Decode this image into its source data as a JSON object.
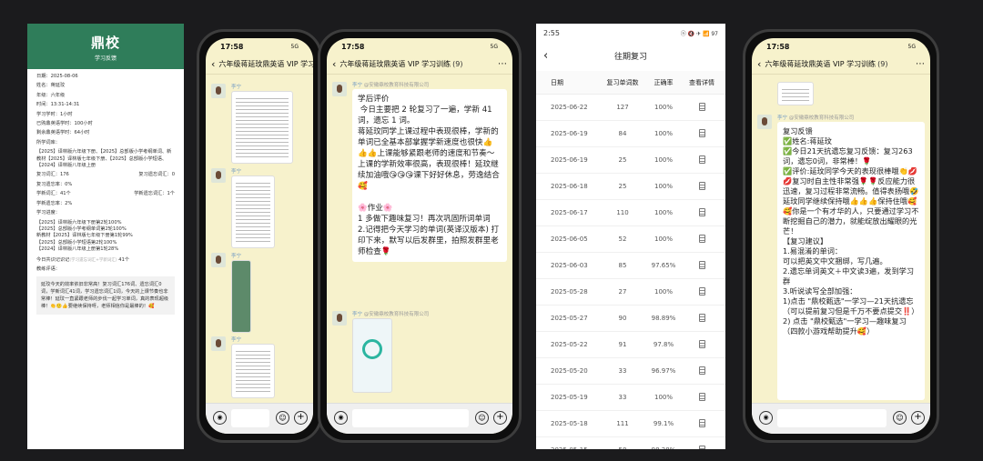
{
  "report": {
    "logo": "鼎校",
    "subtitle": "学习反馈",
    "fields": [
      "日期：2025-08-06",
      "姓名：蒋延玟",
      "年级：六年级",
      "时间：13:31-14:31",
      "学习学时：1小时",
      "已购鼎英语学时：100小时",
      "剩余鼎英语学时：64小时",
      "所学词库：",
      "【2025】译林版六年级下册、【2025】总部版小学考纲单词、新教材【2025】译林版七年级下册、【2025】总部版小学短语、【2024】译林版八年级上册"
    ],
    "stats": [
      [
        "复习词汇：176",
        "复习遗忘词汇：0"
      ],
      [
        "复习遗忘率：0%",
        ""
      ],
      [
        "学新词汇：41个",
        "学新遗忘词汇：1个"
      ],
      [
        "学新遗忘率：2%",
        ""
      ]
    ],
    "progress_label": "学习进度：",
    "progress": [
      "【2025】译林版六年级下册第2轮100%",
      "【2025】总部版小学考纲单词第2轮100%",
      "新教材【2025】译林版七年级下册第1轮99%",
      "【2025】总部版小学短语第2轮100%",
      "【2024】译林版八年级上册第1轮28%"
    ],
    "checkin": "今日共识记识记",
    "checkin_sub": "(学习遗忘词汇+学新词汇)",
    "checkin_count": "41个",
    "comment_label": "教练评语：",
    "comment": "延玟今天的效率依旧非常高！复习词汇176词、遗忘词汇0词，学新词汇41词，学习遗忘词汇1词，今天的上课节奏也非常棒！延玟一直紧跟老师的步伐一起学习单词，真的表现超级棒！👏🙂👍要继续保持呀，老师相信你是最棒的！🥰"
  },
  "chat": {
    "title": "六年级蒋延玟鼎英语 VIP 学习训练",
    "count": "(9)",
    "sender": "李宁",
    "org": "@安徽鼎校教育科技有限公司",
    "time": "17:58",
    "net": "5G"
  },
  "phone2": {
    "text1": "学后评价\n 今日主要把 2 轮复习了一遍，学新 41 词，遗忘 1 词。\n蒋延玟同学上课过程中表现很棒，学新的单词已全基本部掌握学新速度也很快👍👍👍上课能够紧跟老师的速度和节奏～上课的学新效率很高，表现很棒！延玟继续加油哦😘😘😘课下好好休息，劳逸结合🥰",
    "text2": "🌸作业🌸\n1 多做下趣味复习！再次巩固所词单词\n2.记得把今天学习的单词(英译汉版本) 打印下来，默写以后发群里，拍照发群里老师检查🌹"
  },
  "phone4": {
    "text": "复习反馈\n✅姓名:蒋延玟\n✅今日21天抗遗忘复习反馈：复习263词，遗忘0词，非常棒！🌹\n✅评价:延玟同学今天的表现很棒哦👏💋💋复习时自主性非常强🌹🌹反应能力很迅速，复习过程非常流畅。值得表扬哦🤣延玟同学继续保持哦👍👍👍保持住哦🥰🥰你是一个有才华的人，只要通过学习不断挖掘自己的潜力，就能绽放出耀眼的光芒！\n【复习建议】\n1.易混淆的单词：\n可以把英文中文捆绑，写几遍。\n2.遗忘单词英文＋中文读3遍，发到学习群\n3.听说读写全部加强：\n1)点击 \"鼎校甄选\"一学习—21天抗遗忘（可以提前复习但是千万不要点提交‼️）\n2) 点击 \"鼎校甄选\"一学习—趣味复习（四款小游戏帮助提升🥰）"
  },
  "table": {
    "time": "2:55",
    "status_right": "ⓝ 🔇 ✈ 📶 97",
    "title": "往期复习",
    "headers": [
      "日期",
      "复习单词数",
      "正确率",
      "查看详情"
    ],
    "rows": [
      [
        "2025-06-22",
        "127",
        "100%"
      ],
      [
        "2025-06-19",
        "84",
        "100%"
      ],
      [
        "2025-06-19",
        "25",
        "100%"
      ],
      [
        "2025-06-18",
        "25",
        "100%"
      ],
      [
        "2025-06-17",
        "110",
        "100%"
      ],
      [
        "2025-06-05",
        "52",
        "100%"
      ],
      [
        "2025-06-03",
        "85",
        "97.65%"
      ],
      [
        "2025-05-28",
        "27",
        "100%"
      ],
      [
        "2025-05-27",
        "90",
        "98.89%"
      ],
      [
        "2025-05-22",
        "91",
        "97.8%"
      ],
      [
        "2025-05-20",
        "33",
        "96.97%"
      ],
      [
        "2025-05-19",
        "33",
        "100%"
      ],
      [
        "2025-05-18",
        "111",
        "99.1%"
      ],
      [
        "2025-05-15",
        "58",
        "98.28%"
      ]
    ]
  }
}
